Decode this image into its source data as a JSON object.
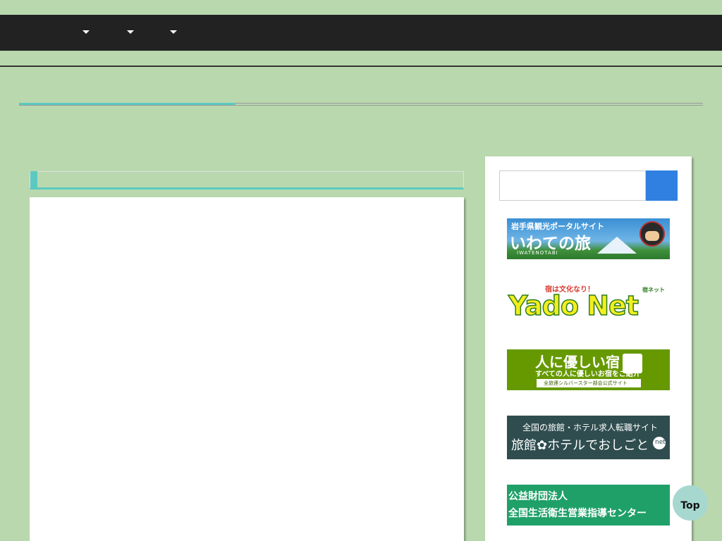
{
  "nav": {
    "items": [
      {
        "icon": "caret-down-icon"
      },
      {
        "icon": "caret-down-icon"
      },
      {
        "icon": "caret-down-icon"
      }
    ]
  },
  "page": {
    "title": "",
    "section_title": ""
  },
  "sidebar": {
    "search": {
      "placeholder": "",
      "value": ""
    },
    "banners": [
      {
        "small": "岩手県観光ポータルサイト",
        "main": "いわての旅",
        "sub": "IWATENOTABI"
      },
      {
        "top": "宿は文化なり！",
        "main": "Yado Net",
        "right": "宿ネット"
      },
      {
        "main": "人に優しい宿",
        "sub": "すべての人に優しいお宿をご紹介",
        "small": "全旅連シルバースター部会公式サイト"
      },
      {
        "top": "全国の旅館・ホテル求人転職サイト",
        "main": "旅館✿ホテルでおしごと",
        "badge": "net"
      },
      {
        "line1": "公益財団法人",
        "line2": "全国生活衛生営業指導センター"
      }
    ]
  },
  "top_button": {
    "label": "Top"
  },
  "colors": {
    "background": "#b9d8ae",
    "nav": "#222222",
    "accent": "#5cc9c0",
    "search_button": "#2f80e0",
    "top_button": "#a6d8d0"
  }
}
